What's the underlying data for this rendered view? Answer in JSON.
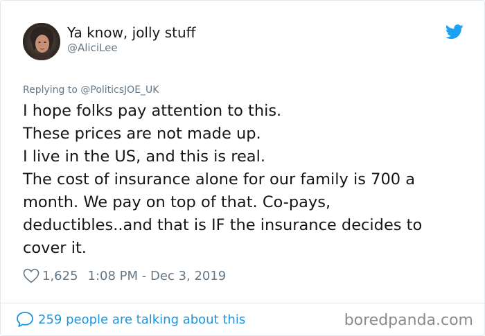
{
  "user": {
    "display_name": "Ya know, jolly stuff",
    "handle": "@AliciLee"
  },
  "reply": {
    "prefix": "Replying to ",
    "to_handle": "@PoliticsJOE_UK"
  },
  "tweet": {
    "lines": [
      "I hope folks pay attention to this.",
      "These prices are not made up.",
      "I live in the US, and this is real.",
      "The cost of insurance alone for our family is 700 a",
      "month. We pay on top of that. Co-pays,",
      "deductibles..and that is IF the insurance decides to",
      "cover it."
    ]
  },
  "meta": {
    "likes": "1,625",
    "timestamp": "1:08 PM - Dec 3, 2019"
  },
  "footer": {
    "talking": "259 people are talking about this",
    "watermark": "boredpanda.com"
  },
  "icons": {
    "bird": "twitter-bird-icon",
    "heart": "heart-icon",
    "bubble": "speech-bubble-icon"
  },
  "colors": {
    "twitter_blue": "#1da1f2",
    "link_blue": "#1b95e0",
    "text": "#14171a",
    "secondary": "#657786"
  }
}
